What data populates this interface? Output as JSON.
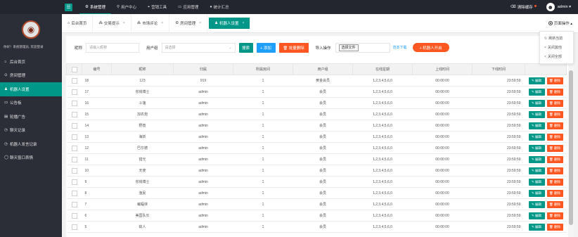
{
  "topbar": {
    "nav": [
      {
        "icon": "⚙",
        "label": "系统管理",
        "active": true
      },
      {
        "icon": "⚲",
        "label": "用户中心"
      },
      {
        "icon": "⌖",
        "label": "营销工具"
      },
      {
        "icon": "▭",
        "label": "应用管理"
      },
      {
        "icon": "●",
        "label": "统计汇总"
      }
    ],
    "clear_cache": "清除缓存",
    "user": "admin ▾"
  },
  "sidebar": {
    "welcome": "你好！系统管理员, 欢迎登录",
    "items": [
      {
        "icon": "⌂",
        "label": "后台首页"
      },
      {
        "icon": "⊙",
        "label": "房间管理"
      },
      {
        "icon": "♟",
        "label": "机器人设置",
        "active": true
      },
      {
        "icon": "▭",
        "label": "公告板"
      },
      {
        "icon": "▤",
        "label": "轮播广告"
      },
      {
        "icon": "◷",
        "label": "聊天记录"
      },
      {
        "icon": "◷",
        "label": "机器人发言记录"
      },
      {
        "icon": "◯",
        "label": "聊天窗口表情"
      }
    ]
  },
  "tabs": [
    {
      "icon": "⌂",
      "label": "后台首页",
      "close": ""
    },
    {
      "icon": "⁂",
      "label": "交易提示",
      "close": "×"
    },
    {
      "icon": "⁂",
      "label": "市场评论",
      "close": "×"
    },
    {
      "icon": "⚙",
      "label": "房间管理",
      "close": "×"
    },
    {
      "icon": "♟",
      "label": "机器人设置",
      "close": "×",
      "active": true
    }
  ],
  "page_ops": {
    "label": "页面操作 ▴",
    "menu": [
      {
        "icon": "↻",
        "label": "刷新当前"
      },
      {
        "icon": "×",
        "label": "关闭其他"
      },
      {
        "icon": "×",
        "label": "关闭全部"
      }
    ]
  },
  "filters": {
    "nickname_label": "昵称",
    "nickname_placeholder": "请输入昵称",
    "group_label": "用户组",
    "group_value": "请选择",
    "group_caret": "⌄",
    "search_btn": "搜索",
    "add_btn": "+ 添加",
    "batch_delete_btn": "🗑 批量删除",
    "import_label": "导入操作",
    "choose_file_btn": "选择文件",
    "template_link": "范本下载",
    "robot_launch_btn": "+ 机器人开启"
  },
  "table": {
    "headers": [
      "编号",
      "昵称",
      "归属",
      "所属房间",
      "用户组",
      "在线星期",
      "上线时间",
      "下线时间"
    ],
    "edit_label": "✎ 编辑",
    "delete_label": "🗑 删除",
    "rows": [
      [
        "18",
        "123",
        "919",
        "1",
        "黄金会员",
        "1,2,3,4,5,6,0",
        "00:00:00",
        "23:59:59"
      ],
      [
        "17",
        "省钱博士",
        "admin",
        "1",
        "会员",
        "1,2,3,4,5,6,0",
        "00:00:00",
        "23:59:59"
      ],
      [
        "16",
        "斗篷",
        "admin",
        "1",
        "会员",
        "1,2,3,4,5,6,0",
        "00:00:00",
        "23:59:59"
      ],
      [
        "15",
        "加农炮",
        "admin",
        "1",
        "会员",
        "1,2,3,4,5,6,0",
        "00:00:00",
        "23:59:59"
      ],
      [
        "14",
        "野兽",
        "admin",
        "1",
        "会员",
        "1,2,3,4,5,6,0",
        "00:00:00",
        "23:59:59"
      ],
      [
        "13",
        "海妖",
        "admin",
        "1",
        "会员",
        "1,2,3,4,5,6,0",
        "00:00:00",
        "23:59:59"
      ],
      [
        "12",
        "巴尔德",
        "admin",
        "1",
        "会员",
        "1,2,3,4,5,6,0",
        "00:00:00",
        "23:59:59"
      ],
      [
        "11",
        "猎光",
        "admin",
        "1",
        "会员",
        "1,2,3,4,5,6,0",
        "00:00:00",
        "23:59:59"
      ],
      [
        "10",
        "天使",
        "admin",
        "1",
        "会员",
        "1,2,3,4,5,6,0",
        "00:00:00",
        "23:59:59"
      ],
      [
        "9",
        "省钱博士",
        "admin",
        "1",
        "会员",
        "1,2,3,4,5,6,0",
        "00:00:00",
        "23:59:59"
      ],
      [
        "8",
        "渔民",
        "admin",
        "1",
        "会员",
        "1,2,3,4,5,6,0",
        "00:00:00",
        "23:59:59"
      ],
      [
        "7",
        "蝙蝠侠",
        "admin",
        "1",
        "会员",
        "1,2,3,4,5,6,0",
        "00:00:00",
        "23:59:59"
      ],
      [
        "6",
        "美国队长",
        "admin",
        "1",
        "会员",
        "1,2,3,4,5,6,0",
        "00:00:00",
        "23:59:59"
      ],
      [
        "5",
        "蚁人",
        "admin",
        "1",
        "会员",
        "1,2,3,4,5,6,0",
        "00:00:00",
        "23:59:59"
      ]
    ]
  },
  "colors": {
    "accent": "#009688",
    "danger": "#ff5722",
    "info": "#1e9fff",
    "topbar": "#23262e",
    "sidebar": "#2b2e37"
  }
}
